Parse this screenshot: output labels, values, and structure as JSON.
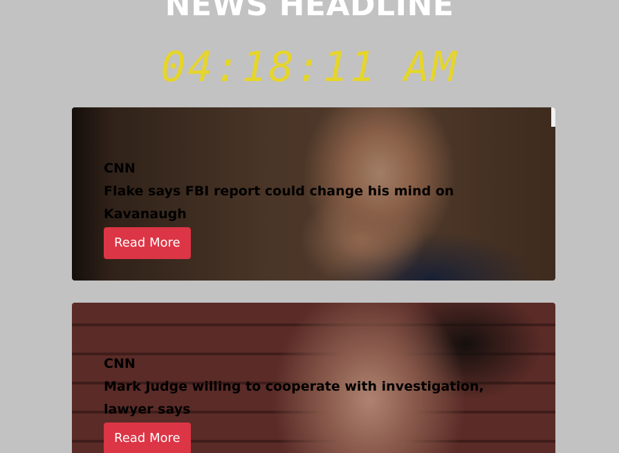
{
  "header": {
    "title": "NEWS HEADLINE",
    "clock": "04:18:11 AM"
  },
  "colors": {
    "background": "#c2c2c2",
    "clock": "#e6d52a",
    "button": "#dc3545"
  },
  "articles": [
    {
      "source": "CNN",
      "headline": "Flake says FBI report could change his mind on Kavanaugh",
      "button_label": "Read More"
    },
    {
      "source": "CNN",
      "headline": "Mark Judge willing to cooperate with investigation, lawyer says",
      "button_label": "Read More"
    }
  ]
}
